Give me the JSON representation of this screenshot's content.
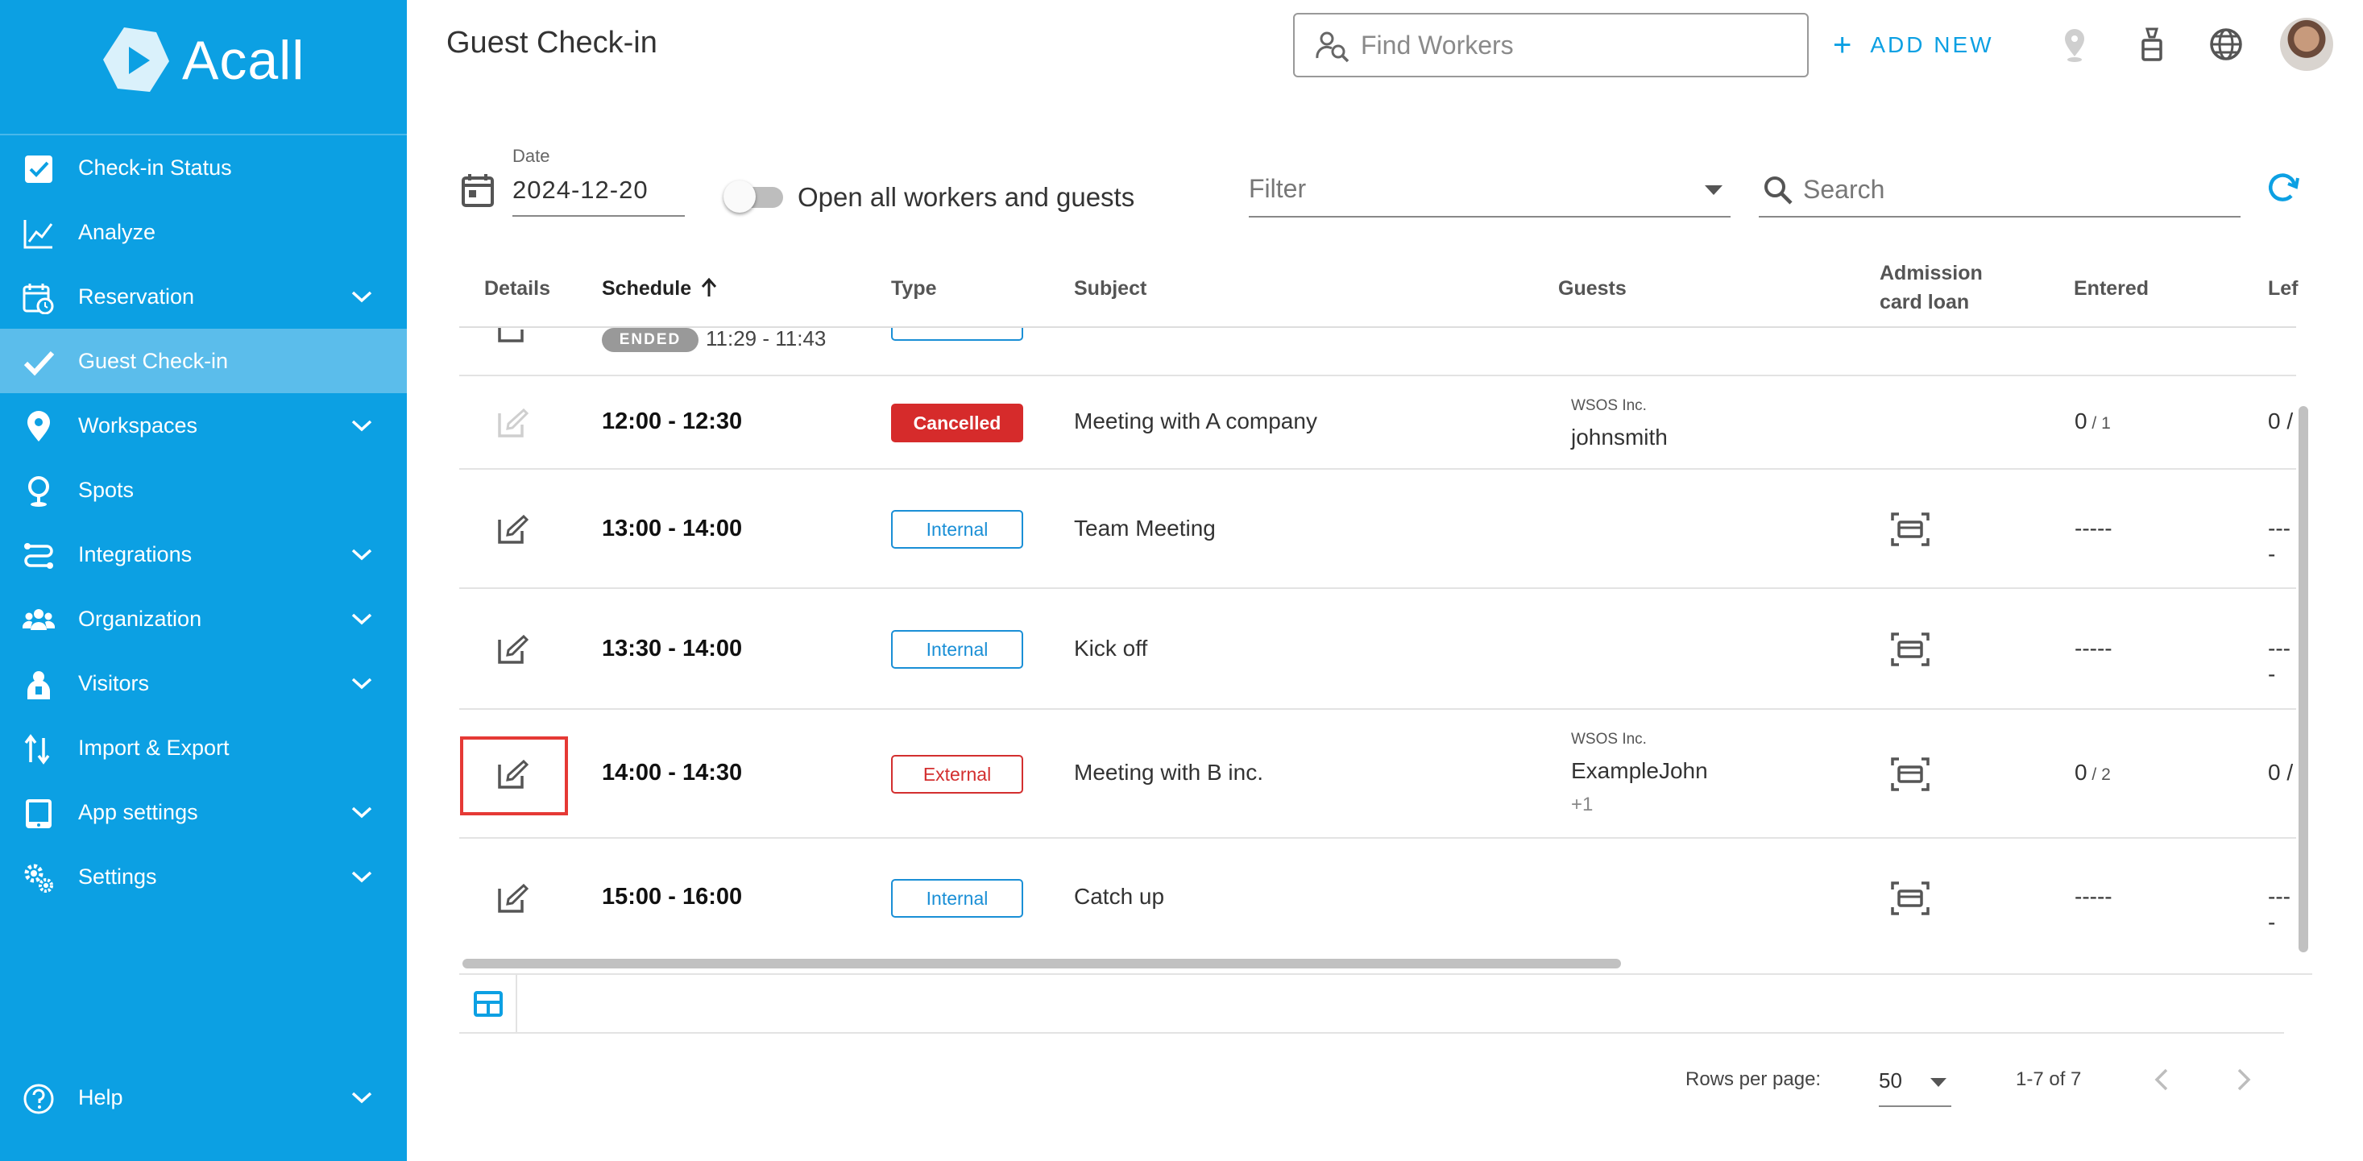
{
  "app": {
    "name": "Acall"
  },
  "sidebar": {
    "items": [
      {
        "label": "Check-in Status",
        "icon": "checkbox-icon",
        "has_children": false
      },
      {
        "label": "Analyze",
        "icon": "chart-line-icon",
        "has_children": false
      },
      {
        "label": "Reservation",
        "icon": "calendar-clock-icon",
        "has_children": true
      },
      {
        "label": "Guest Check-in",
        "icon": "check-icon",
        "has_children": false,
        "active": true
      },
      {
        "label": "Workspaces",
        "icon": "map-pin-icon",
        "has_children": true
      },
      {
        "label": "Spots",
        "icon": "spot-pin-icon",
        "has_children": false
      },
      {
        "label": "Integrations",
        "icon": "integrations-icon",
        "has_children": true
      },
      {
        "label": "Organization",
        "icon": "people-group-icon",
        "has_children": true
      },
      {
        "label": "Visitors",
        "icon": "visitor-icon",
        "has_children": true
      },
      {
        "label": "Import & Export",
        "icon": "import-export-icon",
        "has_children": false
      },
      {
        "label": "App settings",
        "icon": "tablet-icon",
        "has_children": true
      },
      {
        "label": "Settings",
        "icon": "gears-icon",
        "has_children": true
      }
    ],
    "help_label": "Help"
  },
  "header": {
    "title": "Guest Check-in",
    "find_workers_placeholder": "Find Workers",
    "add_new_label": "ADD NEW"
  },
  "controls": {
    "date_label": "Date",
    "date_value": "2024-12-20",
    "toggle_label": "Open all workers and guests",
    "toggle_on": false,
    "filter_placeholder": "Filter",
    "search_placeholder": "Search"
  },
  "table": {
    "columns": {
      "details": "Details",
      "schedule": "Schedule",
      "type": "Type",
      "subject": "Subject",
      "guests": "Guests",
      "admission_line1": "Admission",
      "admission_line2": "card loan",
      "entered": "Entered",
      "left": "Lef"
    },
    "partial_row": {
      "status": "ENDED",
      "time": "11:29 - 11:43"
    },
    "rows": [
      {
        "time": "12:00 - 12:30",
        "type": "Cancelled",
        "subject": "Meeting with A company",
        "company": "WSOS Inc.",
        "guest": "johnsmith",
        "guest_more": "",
        "card": false,
        "entered_num": "0",
        "entered_den": " / 1",
        "left": "0 /"
      },
      {
        "time": "13:00 - 14:00",
        "type": "Internal",
        "subject": "Team Meeting",
        "company": "",
        "guest": "",
        "guest_more": "",
        "card": true,
        "entered_num": "-----",
        "entered_den": "",
        "left": "----"
      },
      {
        "time": "13:30 - 14:00",
        "type": "Internal",
        "subject": "Kick off",
        "company": "",
        "guest": "",
        "guest_more": "",
        "card": true,
        "entered_num": "-----",
        "entered_den": "",
        "left": "----"
      },
      {
        "time": "14:00 - 14:30",
        "type": "External",
        "subject": "Meeting with B inc.",
        "company": "WSOS Inc.",
        "guest": "ExampleJohn",
        "guest_more": "+1",
        "card": true,
        "entered_num": "0",
        "entered_den": " / 2",
        "left": "0 /"
      },
      {
        "time": "15:00 - 16:00",
        "type": "Internal",
        "subject": "Catch up",
        "company": "",
        "guest": "",
        "guest_more": "",
        "card": true,
        "entered_num": "-----",
        "entered_den": "",
        "left": "----"
      }
    ]
  },
  "pagination": {
    "rows_per_page_label": "Rows per page:",
    "rows_per_page": "50",
    "range": "1-7 of 7"
  },
  "colors": {
    "sidebar": "#0ca0e3",
    "sidebar_active": "#5bbdeb",
    "accent": "#0ca0e3",
    "cancelled": "#d62b2b",
    "external": "#d32f2f",
    "internal": "#1a8fd6",
    "highlight": "#e53935"
  }
}
